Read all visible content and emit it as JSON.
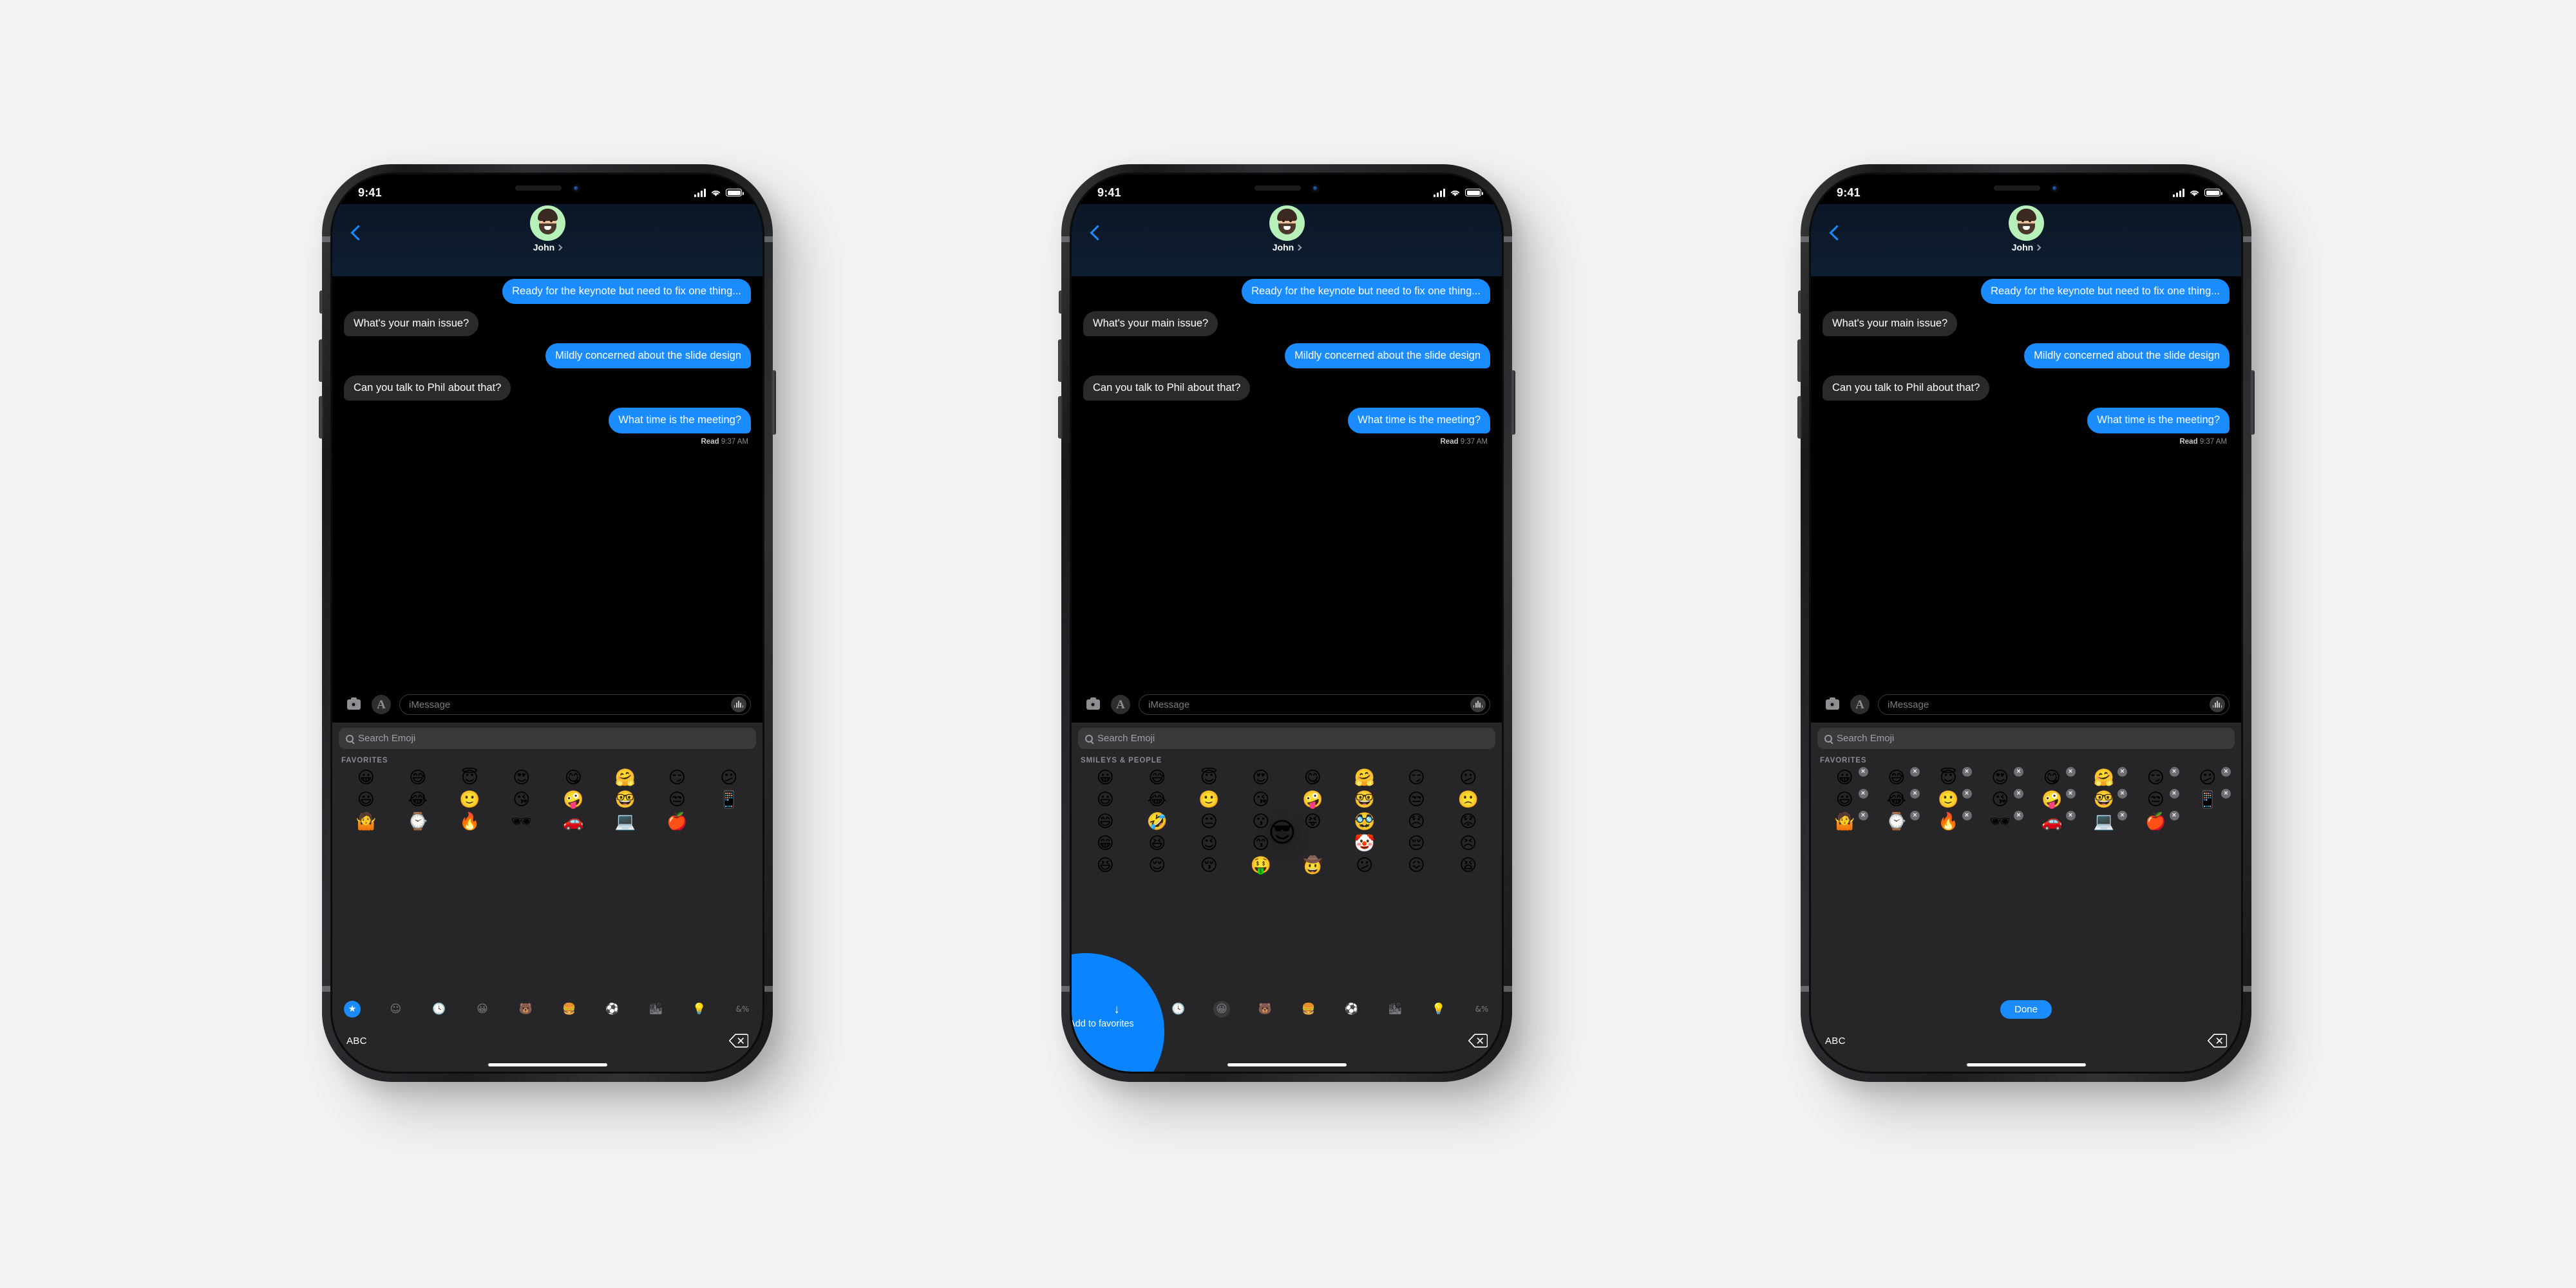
{
  "status_bar": {
    "time": "9:41",
    "signal_icon": "cellular-bars-icon",
    "wifi_icon": "wifi-icon",
    "battery_icon": "battery-icon"
  },
  "conversation": {
    "back_label": "back-chevron",
    "contact_name": "John",
    "messages": [
      {
        "side": "out",
        "text": "Ready for the keynote but need to fix one thing..."
      },
      {
        "side": "in",
        "text": "What's your main issue?"
      },
      {
        "side": "out",
        "text": "Mildly concerned about the slide design"
      },
      {
        "side": "in",
        "text": "Can you talk to Phil about that?"
      },
      {
        "side": "out",
        "text": "What time is the meeting?"
      }
    ],
    "receipt_status": "Read",
    "receipt_time": "9:37 AM"
  },
  "input_bar": {
    "camera_icon": "camera-icon",
    "apps_icon": "app-store-icon",
    "placeholder": "iMessage",
    "audio_icon": "audio-waveform-icon"
  },
  "keyboard": {
    "search_placeholder": "Search Emoji",
    "favorites_label": "FAVORITES",
    "smileys_label": "SMILEYS & PEOPLE",
    "abc_label": "ABC",
    "delete_icon": "backspace-icon",
    "done_label": "Done",
    "delete_badge": "×",
    "categories": [
      {
        "name": "favorites",
        "glyph": "★"
      },
      {
        "name": "memoji",
        "glyph": "☺"
      },
      {
        "name": "recents",
        "glyph": "🕓"
      },
      {
        "name": "smileys",
        "glyph": "😀"
      },
      {
        "name": "animals",
        "glyph": "🐻"
      },
      {
        "name": "food",
        "glyph": "🍔"
      },
      {
        "name": "activities",
        "glyph": "⚽"
      },
      {
        "name": "travel",
        "glyph": "🏙"
      },
      {
        "name": "objects",
        "glyph": "💡"
      },
      {
        "name": "symbols",
        "glyph": "&%"
      }
    ],
    "favorites": [
      "😀",
      "😅",
      "😇",
      "😍",
      "😋",
      "🤗",
      "😏",
      "😕",
      "😃",
      "😂",
      "🙂",
      "😘",
      "🤪",
      "🤓",
      "😒",
      "📱",
      "🤷",
      "⌚",
      "🔥",
      "🕶",
      "🚗",
      "💻",
      "🍎"
    ],
    "smileys_grid": [
      "😀",
      "😅",
      "😇",
      "😍",
      "😋",
      "🤗",
      "😏",
      "😕",
      "😃",
      "😂",
      "🙂",
      "😘",
      "🤪",
      "🤓",
      "😒",
      "🙁",
      "😄",
      "🤣",
      "😐",
      "😗",
      "😝",
      "🥸",
      "😞",
      "😟",
      "😁",
      "😆",
      "😉",
      "😙",
      "😜",
      "🤡",
      "😔",
      "😣",
      "😆",
      "😌",
      "😚",
      "🤑",
      "🤠",
      "😕",
      "😖",
      "😫"
    ],
    "drag_emoji": "😎",
    "drop_target": {
      "arrow": "↓",
      "label": "Add to\nfavorites"
    }
  },
  "colors": {
    "accent_blue": "#1a8cff",
    "bubble_in": "#2a2a2c",
    "keyboard_bg": "#262628",
    "page_bg": "#f2f2f2"
  }
}
